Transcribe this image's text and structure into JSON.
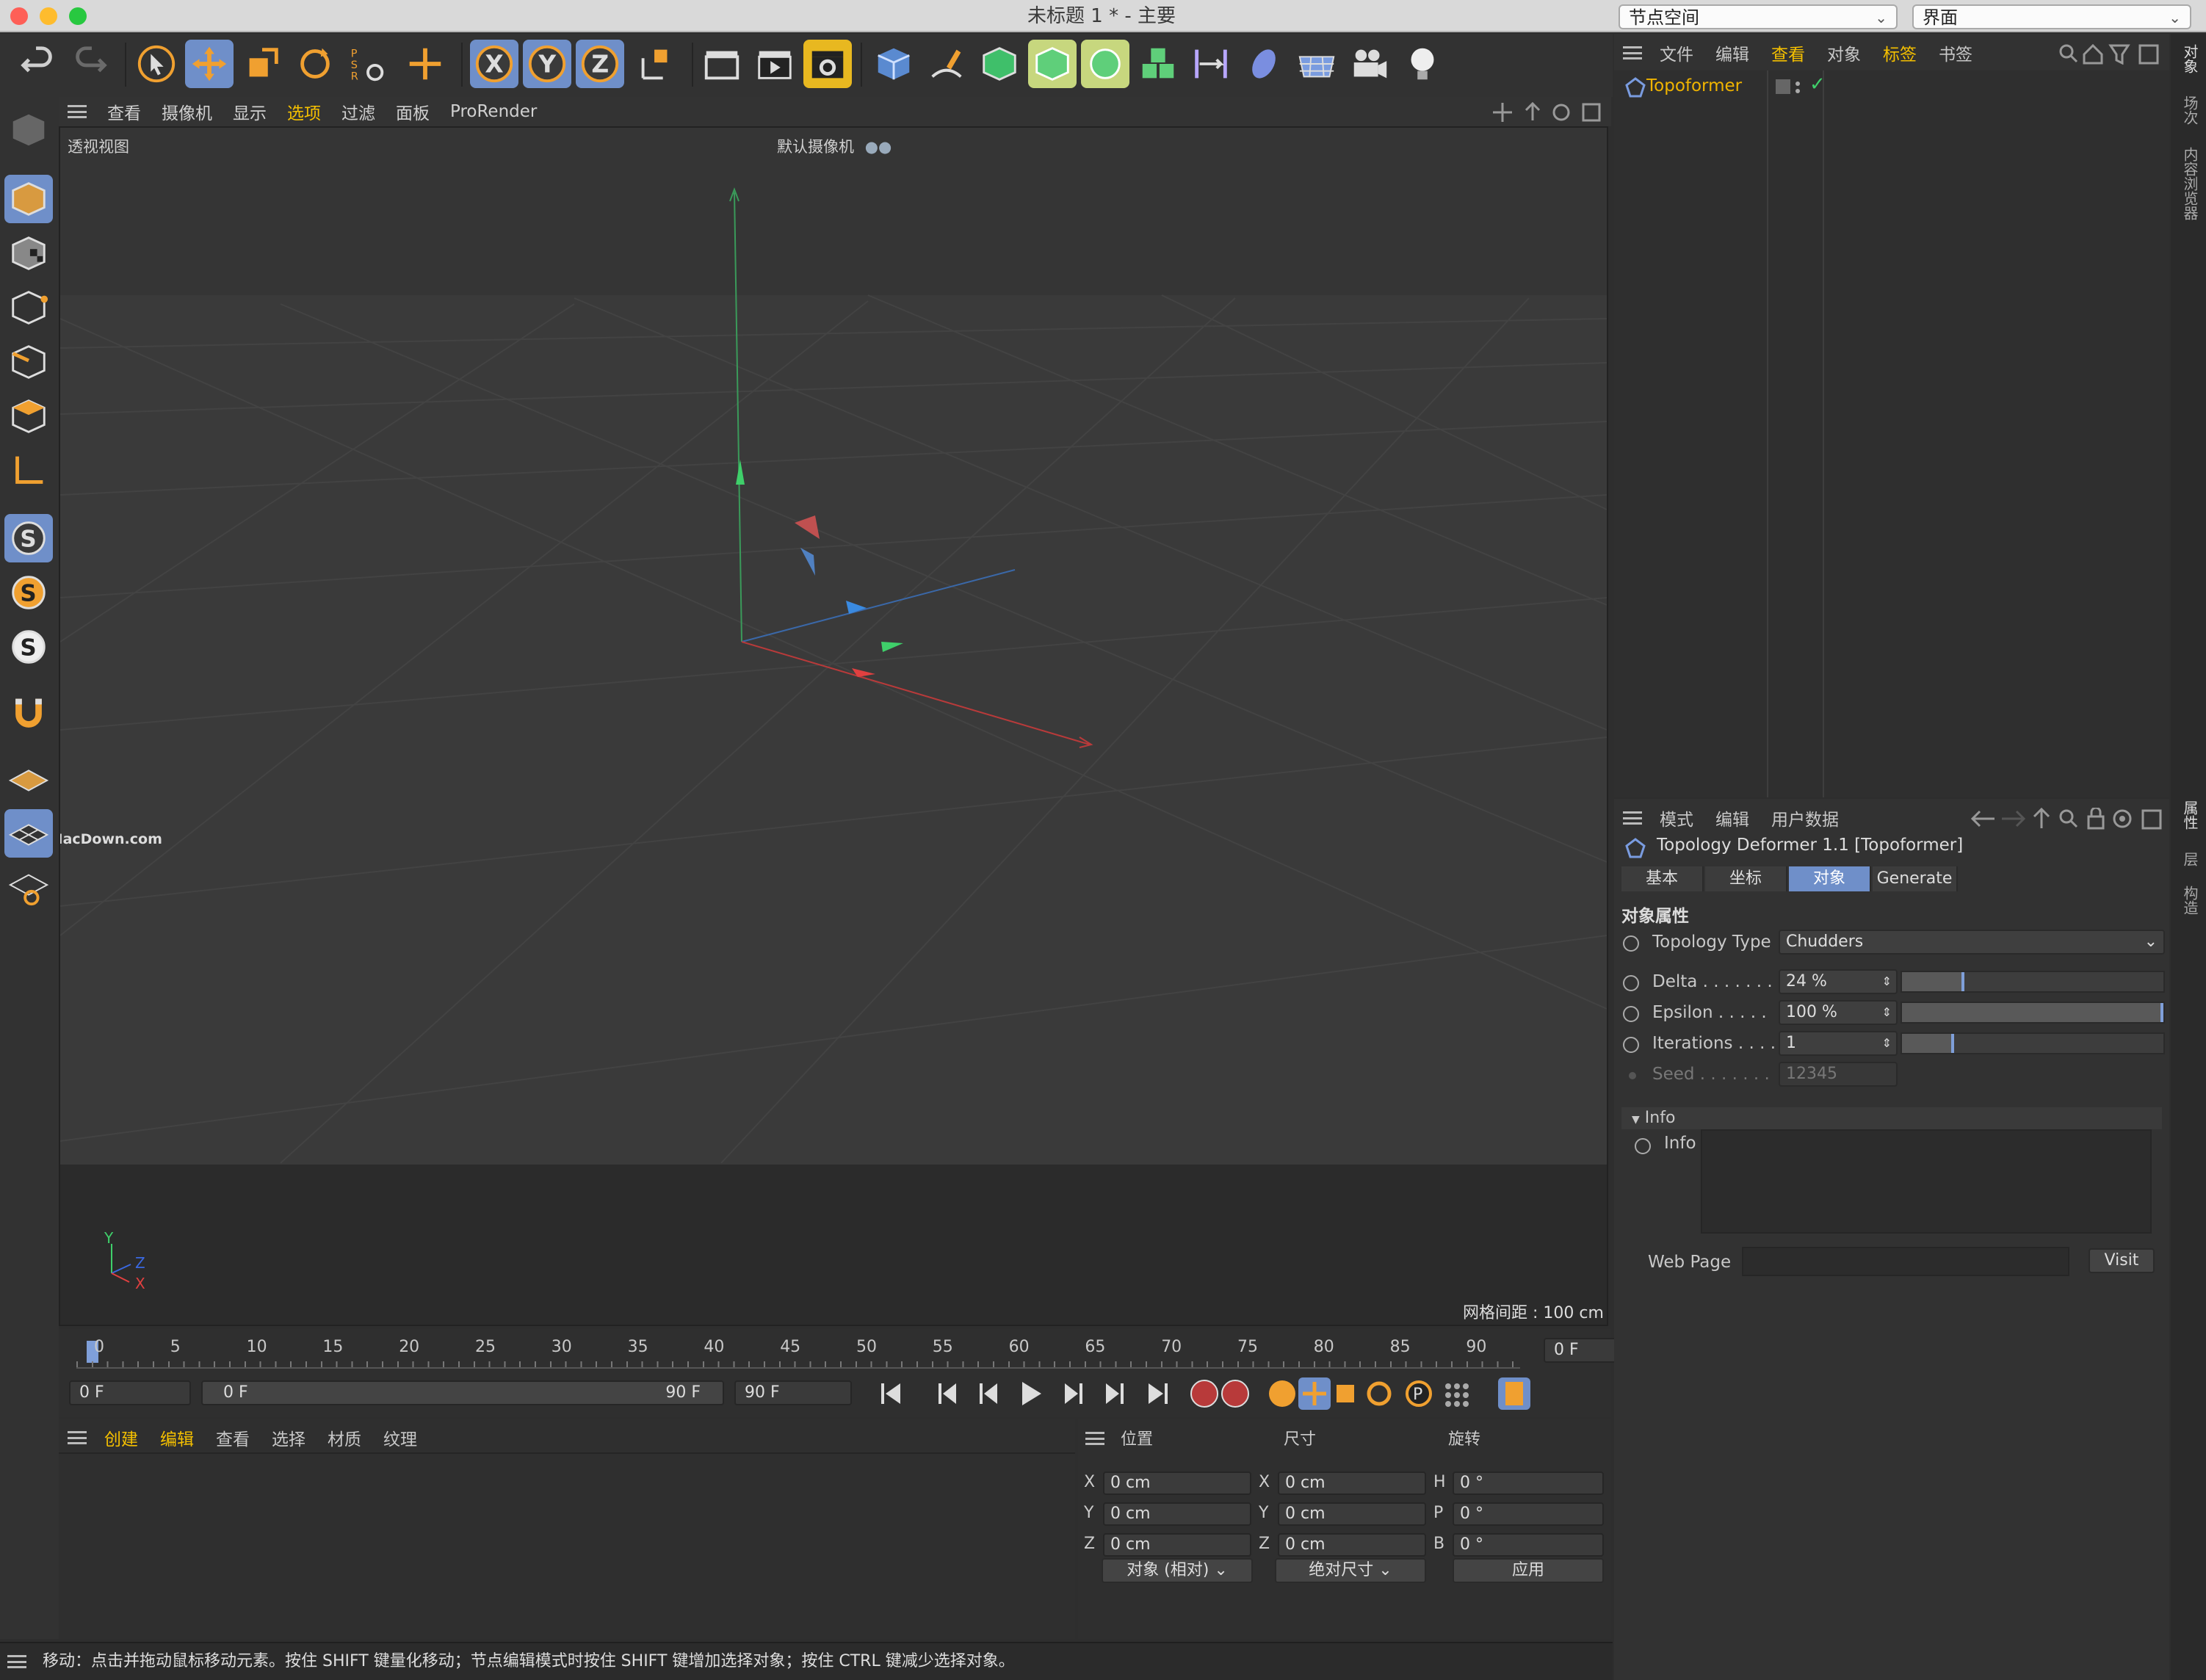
{
  "window": {
    "title": "未标题 1 * - 主要",
    "node_space": "节点空间",
    "layout": "界面"
  },
  "viewport": {
    "menu": [
      "查看",
      "摄像机",
      "显示",
      "选项",
      "过滤",
      "面板",
      "ProRender"
    ],
    "view_name": "透视视图",
    "camera_name": "默认摄像机",
    "grid_spacing": "网格间距 : 100 cm",
    "watermark": "www.MacDown.com",
    "axis_y": "Y",
    "axis_z": "Z",
    "axis_x": "X"
  },
  "timeline": {
    "ticks": [
      "0",
      "5",
      "10",
      "15",
      "20",
      "25",
      "30",
      "35",
      "40",
      "45",
      "50",
      "55",
      "60",
      "65",
      "70",
      "75",
      "80",
      "85",
      "90"
    ],
    "current_frame": "0 F",
    "start_frame": "0 F",
    "range_start": "0 F",
    "range_end": "90 F",
    "end_frame": "90 F"
  },
  "material_panel": {
    "menu": [
      "创建",
      "编辑",
      "查看",
      "选择",
      "材质",
      "纹理"
    ]
  },
  "coords": {
    "headers": {
      "position": "位置",
      "size": "尺寸",
      "rotation": "旋转"
    },
    "rows": [
      {
        "axis": "X",
        "pos": "0 cm",
        "axis2": "X",
        "size": "0 cm",
        "rlabel": "H",
        "rot": "0 °"
      },
      {
        "axis": "Y",
        "pos": "0 cm",
        "axis2": "Y",
        "size": "0 cm",
        "rlabel": "P",
        "rot": "0 °"
      },
      {
        "axis": "Z",
        "pos": "0 cm",
        "axis2": "Z",
        "size": "0 cm",
        "rlabel": "B",
        "rot": "0 °"
      }
    ],
    "mode": "对象 (相对)",
    "size_mode": "绝对尺寸",
    "apply": "应用"
  },
  "status": "移动：点击并拖动鼠标移动元素。按住 SHIFT 键量化移动；节点编辑模式时按住 SHIFT 键增加选择对象；按住 CTRL 键减少选择对象。",
  "object_manager": {
    "menu": [
      "文件",
      "编辑",
      "查看",
      "对象",
      "标签",
      "书签"
    ],
    "objects": [
      {
        "name": "Topoformer"
      }
    ]
  },
  "attribute_manager": {
    "menu": [
      "模式",
      "编辑",
      "用户数据"
    ],
    "object_title": "Topology Deformer 1.1 [Topoformer]",
    "tabs": [
      "基本",
      "坐标",
      "对象",
      "Generate"
    ],
    "active_tab": "对象",
    "section": "对象属性",
    "topology_type_label": "Topology Type",
    "topology_type_value": "Chudders",
    "params": [
      {
        "label": "Delta . . . . . . .",
        "value": "24 %",
        "fraction": 0.24
      },
      {
        "label": "Epsilon . . . . .",
        "value": "100 %",
        "fraction": 1.0
      },
      {
        "label": "Iterations . . . .",
        "value": "1",
        "fraction": 0.2
      }
    ],
    "seed_label": "Seed . . . . . . .",
    "seed_value": "12345",
    "info_group": "Info",
    "info_label": "Info",
    "webpage_label": "Web Page",
    "visit": "Visit"
  },
  "right_tabs_top": [
    "对象",
    "场次",
    "内容浏览器"
  ],
  "right_tabs_bottom": [
    "属性",
    "层",
    "构造"
  ],
  "colors": {
    "accent_orange": "#f0a030",
    "active_blue": "#6f8fc9",
    "selected_text": "#f5c000",
    "object_name": "#f0b400"
  }
}
